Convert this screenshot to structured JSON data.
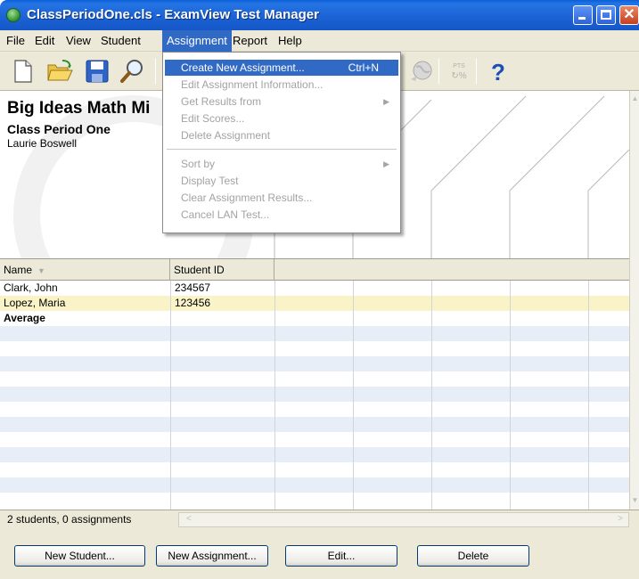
{
  "window": {
    "title": "ClassPeriodOne.cls - ExamView Test Manager"
  },
  "menubar": {
    "items": [
      {
        "label": "File"
      },
      {
        "label": "Edit"
      },
      {
        "label": "View"
      },
      {
        "label": "Student"
      },
      {
        "label": "Assignment"
      },
      {
        "label": "Report"
      },
      {
        "label": "Help"
      }
    ],
    "active": "Assignment"
  },
  "toolbar": {
    "icons": [
      "new-file-icon",
      "open-folder-icon",
      "save-icon",
      "search-icon",
      "globe-icon",
      "points-percent-icon",
      "help-icon"
    ],
    "pts_label": "PTS"
  },
  "assignment_menu": {
    "items": [
      {
        "label": "Create New Assignment...",
        "shortcut": "Ctrl+N",
        "enabled": true,
        "highlighted": true
      },
      {
        "label": "Edit Assignment Information...",
        "enabled": false
      },
      {
        "label": "Get Results from",
        "enabled": false,
        "submenu": true
      },
      {
        "label": "Edit Scores...",
        "enabled": false
      },
      {
        "label": "Delete Assignment",
        "enabled": false
      },
      {
        "label": "Sort by",
        "enabled": false,
        "submenu": true
      },
      {
        "label": "Display Test",
        "enabled": false
      },
      {
        "label": "Clear Assignment Results...",
        "enabled": false
      },
      {
        "label": "Cancel LAN Test...",
        "enabled": false
      }
    ]
  },
  "class_header": {
    "title": "Big Ideas Math Mi",
    "period": "Class Period One",
    "teacher": "Laurie Boswell"
  },
  "grid": {
    "columns": [
      {
        "label": "Name"
      },
      {
        "label": "Student ID"
      }
    ],
    "rows": [
      {
        "name": "Clark, John",
        "id": "234567"
      },
      {
        "name": "Lopez, Maria",
        "id": "123456"
      },
      {
        "name": "Average",
        "id": ""
      }
    ]
  },
  "status": {
    "text": "2 students, 0 assignments"
  },
  "buttons": {
    "new_student": "New Student...",
    "new_assignment": "New Assignment...",
    "edit": "Edit...",
    "delete": "Delete"
  },
  "colors": {
    "title_bar": "#1c63d6",
    "menu_highlight": "#316ac5",
    "selected_row": "#fbf3c8",
    "alt_row": "#e8eef8",
    "chrome": "#ece9d8"
  }
}
